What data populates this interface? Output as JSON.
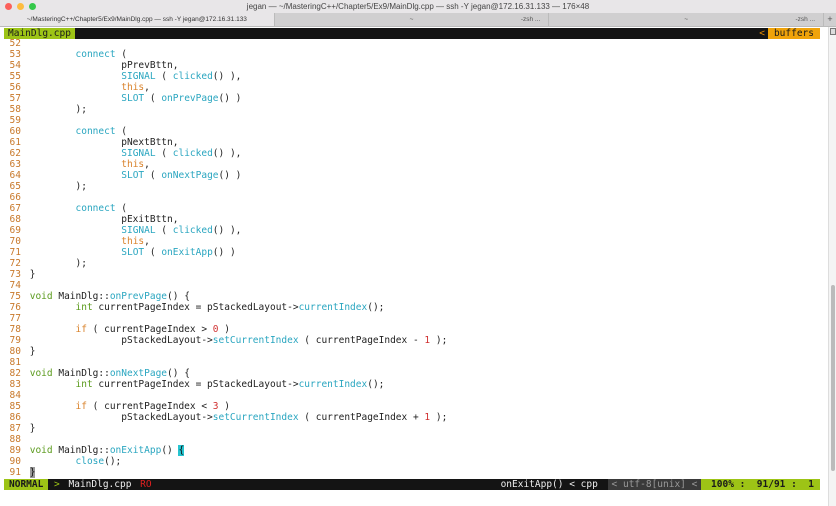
{
  "window": {
    "title": "jegan — ~/MasteringC++/Chapter5/Ex9/MainDlg.cpp — ssh -Y jegan@172.16.31.133 — 176×48"
  },
  "tabs": [
    {
      "label": "~/MasteringC++/Chapter5/Ex9/MainDlg.cpp — ssh -Y jegan@172.16.31.133",
      "right": ""
    },
    {
      "label": "~",
      "right": "-zsh ..."
    },
    {
      "label": "~",
      "right": "-zsh ..."
    }
  ],
  "new_tab": "+",
  "tabline": {
    "file": "MainDlg.cpp",
    "sep": "<",
    "buffers": "buffers"
  },
  "code": [
    {
      "n": "52",
      "t": []
    },
    {
      "n": "53",
      "t": [
        [
          "        ",
          "p"
        ],
        [
          "connect",
          "f"
        ],
        [
          " (",
          "p"
        ]
      ]
    },
    {
      "n": "54",
      "t": [
        [
          "                pPrevBttn,",
          "p"
        ]
      ]
    },
    {
      "n": "55",
      "t": [
        [
          "                ",
          "p"
        ],
        [
          "SIGNAL",
          "f"
        ],
        [
          " ( ",
          "p"
        ],
        [
          "clicked",
          "f"
        ],
        [
          "() ),",
          "p"
        ]
      ]
    },
    {
      "n": "56",
      "t": [
        [
          "                ",
          "p"
        ],
        [
          "this",
          "t"
        ],
        [
          ",",
          "p"
        ]
      ]
    },
    {
      "n": "57",
      "t": [
        [
          "                ",
          "p"
        ],
        [
          "SLOT",
          "f"
        ],
        [
          " ( ",
          "p"
        ],
        [
          "onPrevPage",
          "f"
        ],
        [
          "() )",
          "p"
        ]
      ]
    },
    {
      "n": "58",
      "t": [
        [
          "        );",
          "p"
        ]
      ]
    },
    {
      "n": "59",
      "t": []
    },
    {
      "n": "60",
      "t": [
        [
          "        ",
          "p"
        ],
        [
          "connect",
          "f"
        ],
        [
          " (",
          "p"
        ]
      ]
    },
    {
      "n": "61",
      "t": [
        [
          "                pNextBttn,",
          "p"
        ]
      ]
    },
    {
      "n": "62",
      "t": [
        [
          "                ",
          "p"
        ],
        [
          "SIGNAL",
          "f"
        ],
        [
          " ( ",
          "p"
        ],
        [
          "clicked",
          "f"
        ],
        [
          "() ),",
          "p"
        ]
      ]
    },
    {
      "n": "63",
      "t": [
        [
          "                ",
          "p"
        ],
        [
          "this",
          "t"
        ],
        [
          ",",
          "p"
        ]
      ]
    },
    {
      "n": "64",
      "t": [
        [
          "                ",
          "p"
        ],
        [
          "SLOT",
          "f"
        ],
        [
          " ( ",
          "p"
        ],
        [
          "onNextPage",
          "f"
        ],
        [
          "() )",
          "p"
        ]
      ]
    },
    {
      "n": "65",
      "t": [
        [
          "        );",
          "p"
        ]
      ]
    },
    {
      "n": "66",
      "t": []
    },
    {
      "n": "67",
      "t": [
        [
          "        ",
          "p"
        ],
        [
          "connect",
          "f"
        ],
        [
          " (",
          "p"
        ]
      ]
    },
    {
      "n": "68",
      "t": [
        [
          "                pExitBttn,",
          "p"
        ]
      ]
    },
    {
      "n": "69",
      "t": [
        [
          "                ",
          "p"
        ],
        [
          "SIGNAL",
          "f"
        ],
        [
          " ( ",
          "p"
        ],
        [
          "clicked",
          "f"
        ],
        [
          "() ),",
          "p"
        ]
      ]
    },
    {
      "n": "70",
      "t": [
        [
          "                ",
          "p"
        ],
        [
          "this",
          "t"
        ],
        [
          ",",
          "p"
        ]
      ]
    },
    {
      "n": "71",
      "t": [
        [
          "                ",
          "p"
        ],
        [
          "SLOT",
          "f"
        ],
        [
          " ( ",
          "p"
        ],
        [
          "onExitApp",
          "f"
        ],
        [
          "() )",
          "p"
        ]
      ]
    },
    {
      "n": "72",
      "t": [
        [
          "        );",
          "p"
        ]
      ]
    },
    {
      "n": "73",
      "t": [
        [
          "}",
          "p"
        ]
      ]
    },
    {
      "n": "74",
      "t": []
    },
    {
      "n": "75",
      "t": [
        [
          "void",
          "k"
        ],
        [
          " MainDlg::",
          "p"
        ],
        [
          "onPrevPage",
          "f"
        ],
        [
          "() {",
          "p"
        ]
      ]
    },
    {
      "n": "76",
      "t": [
        [
          "        ",
          "p"
        ],
        [
          "int",
          "k"
        ],
        [
          " currentPageIndex = pStackedLayout->",
          "p"
        ],
        [
          "currentIndex",
          "f"
        ],
        [
          "();",
          "p"
        ]
      ]
    },
    {
      "n": "77",
      "t": []
    },
    {
      "n": "78",
      "t": [
        [
          "        ",
          "p"
        ],
        [
          "if",
          "t"
        ],
        [
          " ( currentPageIndex > ",
          "p"
        ],
        [
          "0",
          "n"
        ],
        [
          " )",
          "p"
        ]
      ]
    },
    {
      "n": "79",
      "t": [
        [
          "                pStackedLayout->",
          "p"
        ],
        [
          "setCurrentIndex",
          "f"
        ],
        [
          " ( currentPageIndex - ",
          "p"
        ],
        [
          "1",
          "n"
        ],
        [
          " );",
          "p"
        ]
      ]
    },
    {
      "n": "80",
      "t": [
        [
          "}",
          "p"
        ]
      ]
    },
    {
      "n": "81",
      "t": []
    },
    {
      "n": "82",
      "t": [
        [
          "void",
          "k"
        ],
        [
          " MainDlg::",
          "p"
        ],
        [
          "onNextPage",
          "f"
        ],
        [
          "() {",
          "p"
        ]
      ]
    },
    {
      "n": "83",
      "t": [
        [
          "        ",
          "p"
        ],
        [
          "int",
          "k"
        ],
        [
          " currentPageIndex = pStackedLayout->",
          "p"
        ],
        [
          "currentIndex",
          "f"
        ],
        [
          "();",
          "p"
        ]
      ]
    },
    {
      "n": "84",
      "t": []
    },
    {
      "n": "85",
      "t": [
        [
          "        ",
          "p"
        ],
        [
          "if",
          "t"
        ],
        [
          " ( currentPageIndex < ",
          "p"
        ],
        [
          "3",
          "n"
        ],
        [
          " )",
          "p"
        ]
      ]
    },
    {
      "n": "86",
      "t": [
        [
          "                pStackedLayout->",
          "p"
        ],
        [
          "setCurrentIndex",
          "f"
        ],
        [
          " ( currentPageIndex + ",
          "p"
        ],
        [
          "1",
          "n"
        ],
        [
          " );",
          "p"
        ]
      ]
    },
    {
      "n": "87",
      "t": [
        [
          "}",
          "p"
        ]
      ]
    },
    {
      "n": "88",
      "t": []
    },
    {
      "n": "89",
      "t": [
        [
          "void",
          "k"
        ],
        [
          " MainDlg::",
          "p"
        ],
        [
          "onExitApp",
          "f"
        ],
        [
          "() ",
          "p"
        ],
        [
          "{",
          "cur"
        ]
      ]
    },
    {
      "n": "90",
      "t": [
        [
          "        ",
          "p"
        ],
        [
          "close",
          "f"
        ],
        [
          "();",
          "p"
        ]
      ]
    },
    {
      "n": "91",
      "t": [
        [
          "}",
          "curg"
        ]
      ]
    }
  ],
  "status": {
    "mode": "NORMAL",
    "sep1": " > ",
    "file": "MainDlg.cpp ",
    "ro": "RO",
    "func": "onExitApp() < cpp ",
    "enc": "< utf-8[unix] <",
    "pos": " 100% :  91/91 :  1"
  },
  "colors": {
    "keyword": "#5a9a1c",
    "function": "#2aa6c0",
    "number": "#d03030",
    "line_number": "#c8782a",
    "accent": "#9dc416",
    "buffers": "#f0a30a"
  }
}
